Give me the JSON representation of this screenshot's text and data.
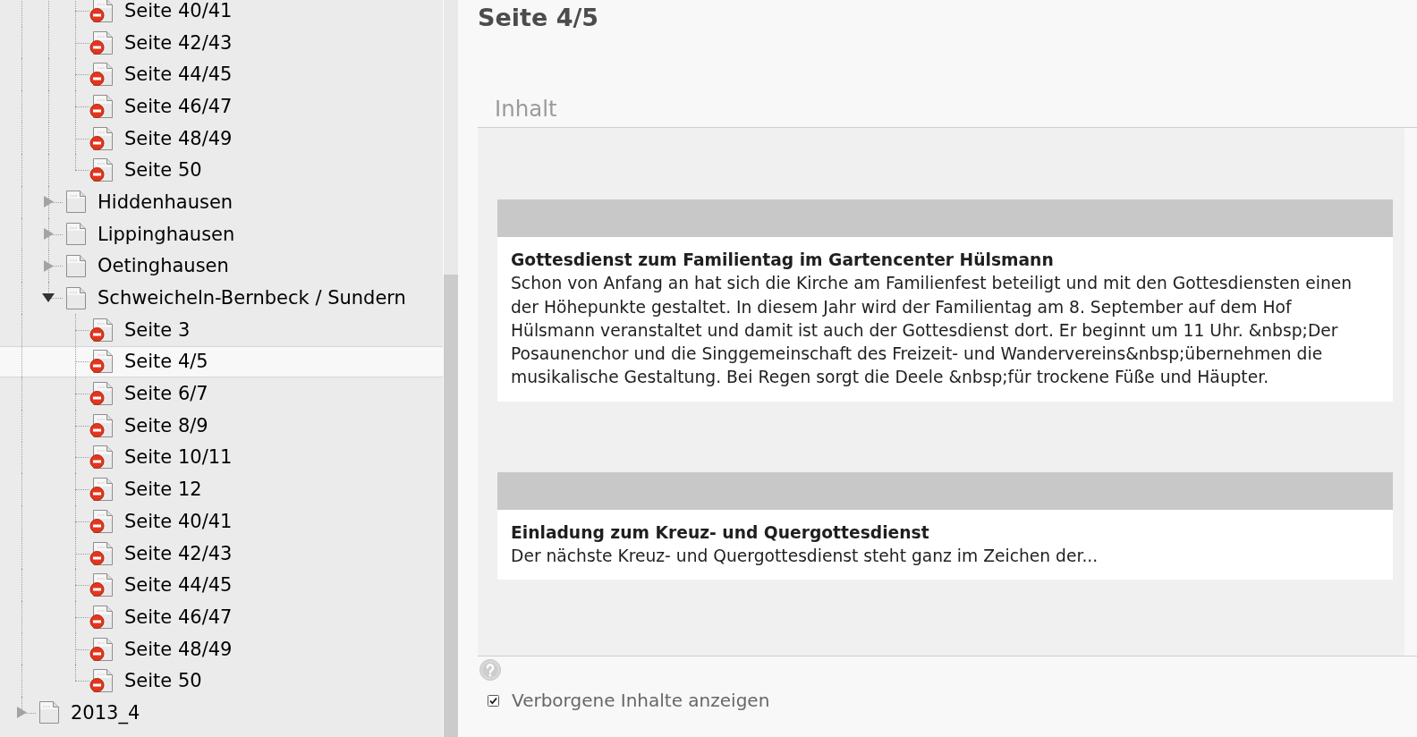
{
  "page_tree": {
    "items": [
      {
        "children": [
          {
            "children": [
              {
                "label": "Seite 40/41",
                "hidden": true,
                "selected": false
              },
              {
                "label": "Seite 42/43",
                "hidden": true,
                "selected": false
              },
              {
                "label": "Seite 44/45",
                "hidden": true,
                "selected": false
              },
              {
                "label": "Seite 46/47",
                "hidden": true,
                "selected": false
              },
              {
                "label": "Seite 48/49",
                "hidden": true,
                "selected": false
              },
              {
                "label": "Seite 50",
                "hidden": true,
                "selected": false
              }
            ]
          },
          {
            "label": "Hiddenhausen",
            "expanded": false,
            "hidden": false,
            "selected": false
          },
          {
            "label": "Lippinghausen",
            "expanded": false,
            "hidden": false,
            "selected": false
          },
          {
            "label": "Oetinghausen",
            "expanded": false,
            "hidden": false,
            "selected": false
          },
          {
            "label": "Schweicheln-Bernbeck / Sundern",
            "expanded": true,
            "hidden": false,
            "selected": false,
            "children": [
              {
                "label": "Seite 3",
                "hidden": true,
                "selected": false
              },
              {
                "label": "Seite 4/5",
                "hidden": true,
                "selected": true
              },
              {
                "label": "Seite 6/7",
                "hidden": true,
                "selected": false
              },
              {
                "label": "Seite 8/9",
                "hidden": true,
                "selected": false
              },
              {
                "label": "Seite 10/11",
                "hidden": true,
                "selected": false
              },
              {
                "label": "Seite 12",
                "hidden": true,
                "selected": false
              },
              {
                "label": "Seite 40/41",
                "hidden": true,
                "selected": false
              },
              {
                "label": "Seite 42/43",
                "hidden": true,
                "selected": false
              },
              {
                "label": "Seite 44/45",
                "hidden": true,
                "selected": false
              },
              {
                "label": "Seite 46/47",
                "hidden": true,
                "selected": false
              },
              {
                "label": "Seite 48/49",
                "hidden": true,
                "selected": false
              },
              {
                "label": "Seite 50",
                "hidden": true,
                "selected": false
              }
            ]
          }
        ]
      },
      {
        "label": "2013_4",
        "expanded": false,
        "hidden": false,
        "selected": false
      }
    ]
  },
  "content": {
    "title": "Seite 4/5",
    "column_title": "Inhalt",
    "elements": [
      {
        "header": "Gottesdienst zum Familientag im Gartencenter Hülsmann",
        "text": "Schon von Anfang an hat sich die Kirche am Familienfest beteiligt und mit den Gottesdiensten einen der Höhepunkte gestaltet. In diesem Jahr wird der Familientag am 8. September auf dem Hof Hülsmann veranstaltet und damit ist auch der Gottesdienst dort. Er beginnt um 11 Uhr. &nbsp;Der Posaunenchor und die Singgemeinschaft des Freizeit- und Wandervereins&nbsp;übernehmen die musikalische Gestaltung. Bei Regen sorgt die Deele &nbsp;für trockene Füße und Häupter."
      },
      {
        "header": "Einladung zum Kreuz- und Quergottesdienst",
        "text": "Der nächste Kreuz- und Quergottesdienst steht ganz im Zeichen der..."
      }
    ]
  },
  "footer": {
    "show_hidden_content": {
      "label": "Verborgene Inhalte anzeigen",
      "checked": true
    }
  }
}
